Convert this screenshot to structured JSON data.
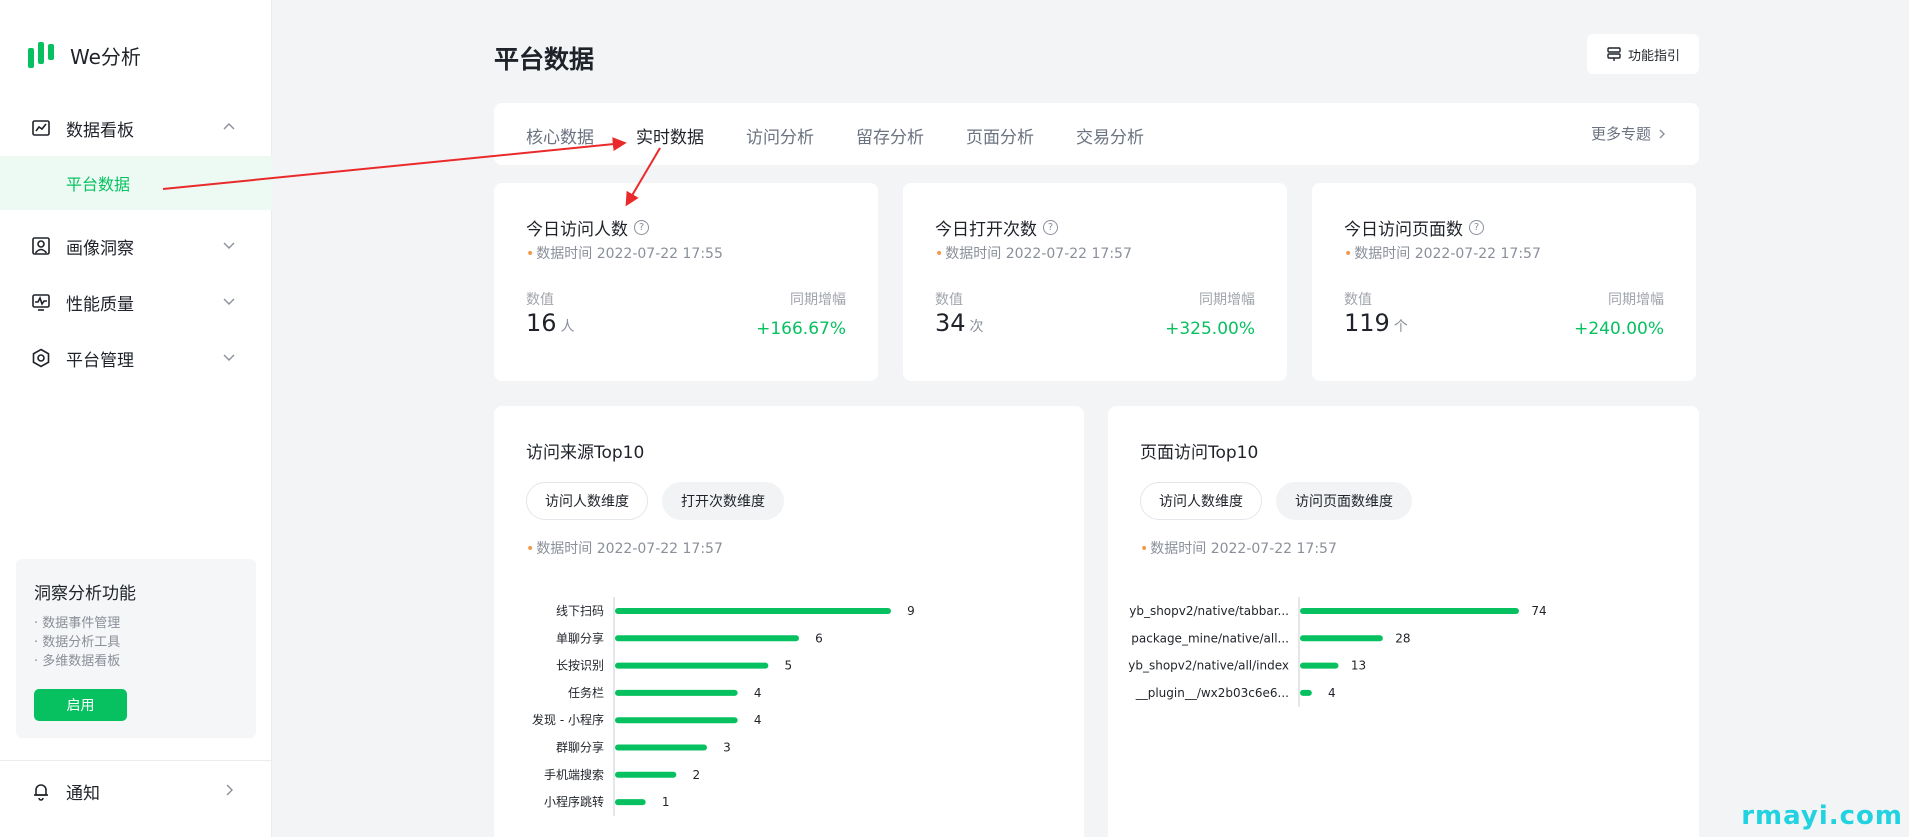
{
  "app": {
    "name": "We分析"
  },
  "sidebar": {
    "items": [
      {
        "label": "数据看板",
        "icon": "dashboard-icon",
        "expanded": true,
        "sub": [
          {
            "label": "平台数据",
            "active": true
          }
        ]
      },
      {
        "label": "画像洞察",
        "icon": "portrait-icon",
        "expanded": false
      },
      {
        "label": "性能质量",
        "icon": "monitor-icon",
        "expanded": false
      },
      {
        "label": "平台管理",
        "icon": "hexagon-icon",
        "expanded": false
      }
    ],
    "promo": {
      "title": "洞察分析功能",
      "items": [
        "· 数据事件管理",
        "· 数据分析工具",
        "· 多维数据看板"
      ],
      "button": "启用"
    },
    "notify": {
      "label": "通知",
      "icon": "bell-icon"
    }
  },
  "header": {
    "title": "平台数据",
    "guide_label": "功能指引"
  },
  "tabs": {
    "items": [
      "核心数据",
      "实时数据",
      "访问分析",
      "留存分析",
      "页面分析",
      "交易分析"
    ],
    "active_index": 1,
    "more": "更多专题"
  },
  "stats": [
    {
      "title": "今日访问人数",
      "time": "数据时间 2022-07-22 17:55",
      "value_label": "数值",
      "growth_label": "同期增幅",
      "value": "16",
      "unit": "人",
      "growth": "+166.67%"
    },
    {
      "title": "今日打开次数",
      "time": "数据时间 2022-07-22 17:57",
      "value_label": "数值",
      "growth_label": "同期增幅",
      "value": "34",
      "unit": "次",
      "growth": "+325.00%"
    },
    {
      "title": "今日访问页面数",
      "time": "数据时间 2022-07-22 17:57",
      "value_label": "数值",
      "growth_label": "同期增幅",
      "value": "119",
      "unit": "个",
      "growth": "+240.00%"
    }
  ],
  "panels": [
    {
      "title": "访问来源Top10",
      "pills": [
        "访问人数维度",
        "打开次数维度"
      ],
      "active_pill": 1,
      "time": "数据时间 2022-07-22 17:57"
    },
    {
      "title": "页面访问Top10",
      "pills": [
        "访问人数维度",
        "访问页面数维度"
      ],
      "active_pill": 1,
      "time": "数据时间 2022-07-22 17:57"
    }
  ],
  "colors": {
    "accent": "#07c160",
    "dot": "#f2994a",
    "annotation": "#ea2a2a"
  },
  "watermark": "rmayi.com",
  "chart_data": [
    {
      "type": "bar",
      "orientation": "horizontal",
      "categories": [
        "线下扫码",
        "单聊分享",
        "长按识别",
        "任务栏",
        "发现 - 小程序",
        "群聊分享",
        "手机端搜索",
        "小程序跳转"
      ],
      "values": [
        9,
        6,
        5,
        4,
        4,
        3,
        2,
        1
      ],
      "xlim": [
        0,
        9
      ],
      "grid": false,
      "data_labels": true
    },
    {
      "type": "bar",
      "orientation": "horizontal",
      "categories": [
        "yb_shopv2/native/tabbar...",
        "package_mine/native/all...",
        "yb_shopv2/native/all/index",
        "__plugin__/wx2b03c6e6..."
      ],
      "values": [
        74,
        28,
        13,
        4
      ],
      "xlim": [
        0,
        74
      ],
      "grid": false,
      "data_labels": true
    }
  ]
}
